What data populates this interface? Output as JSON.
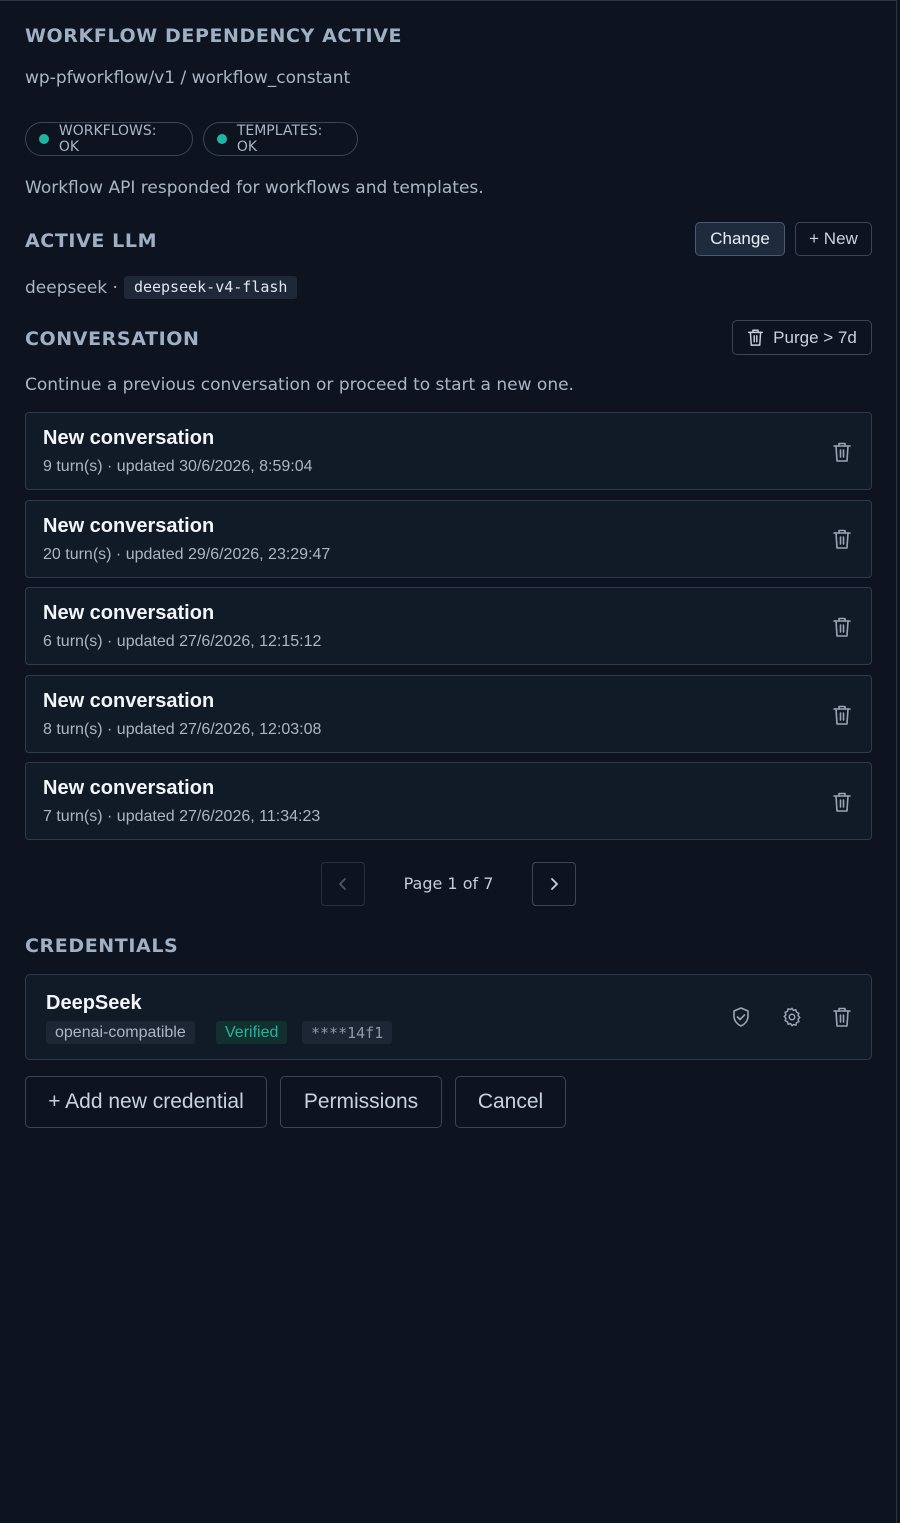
{
  "workflow": {
    "title": "WORKFLOW DEPENDENCY ACTIVE",
    "path": "wp-pfworkflow/v1 / workflow_constant",
    "status_pills": [
      {
        "label": "WORKFLOWS: OK",
        "color": "#1fb5a0"
      },
      {
        "label": "TEMPLATES: OK",
        "color": "#1fb5a0"
      }
    ],
    "message": "Workflow API responded for workflows and templates."
  },
  "llm": {
    "title": "ACTIVE LLM",
    "change_label": "Change",
    "new_label": "+ New",
    "provider": "deepseek ·",
    "model": "deepseek-v4-flash"
  },
  "conversation": {
    "title": "CONVERSATION",
    "purge_label": "Purge > 7d",
    "hint": "Continue a previous conversation or proceed to start a new one.",
    "items": [
      {
        "title": "New conversation",
        "meta": "9 turn(s) · updated 30/6/2026, 8:59:04"
      },
      {
        "title": "New conversation",
        "meta": "20 turn(s) · updated 29/6/2026, 23:29:47"
      },
      {
        "title": "New conversation",
        "meta": "6 turn(s) · updated 27/6/2026, 12:15:12"
      },
      {
        "title": "New conversation",
        "meta": "8 turn(s) · updated 27/6/2026, 12:03:08"
      },
      {
        "title": "New conversation",
        "meta": "7 turn(s) · updated 27/6/2026, 11:34:23"
      }
    ],
    "pagination": {
      "label": "Page 1 of 7"
    }
  },
  "credentials": {
    "title": "CREDENTIALS",
    "items": [
      {
        "name": "DeepSeek",
        "type": "openai-compatible",
        "status": "Verified",
        "status_color": "#1fb5a0",
        "key": "****14f1"
      }
    ],
    "add_label": "+ Add new credential",
    "permissions_label": "Permissions",
    "cancel_label": "Cancel"
  },
  "icons": {
    "trash": "trash-icon",
    "shield": "shield-check-icon",
    "gear": "gear-icon",
    "chevron_left": "chevron-left-icon",
    "chevron_right": "chevron-right-icon"
  }
}
